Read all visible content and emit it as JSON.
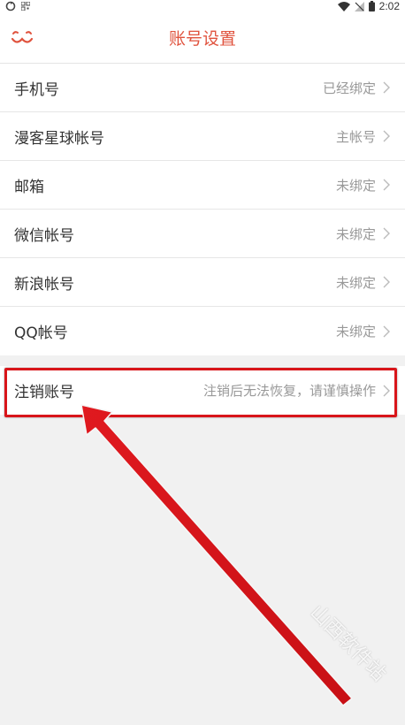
{
  "status_bar": {
    "time": "2:02"
  },
  "header": {
    "title": "账号设置"
  },
  "accounts": [
    {
      "label": "手机号",
      "value": "已经绑定"
    },
    {
      "label": "漫客星球帐号",
      "value": "主帐号"
    },
    {
      "label": "邮箱",
      "value": "未绑定"
    },
    {
      "label": "微信帐号",
      "value": "未绑定"
    },
    {
      "label": "新浪帐号",
      "value": "未绑定"
    },
    {
      "label": "QQ帐号",
      "value": "未绑定"
    }
  ],
  "cancel_account": {
    "label": "注销账号",
    "value": "注销后无法恢复，请谨慎操作"
  },
  "watermark": "山西软件站",
  "colors": {
    "accent": "#e0533e",
    "highlight": "#d8151a"
  }
}
